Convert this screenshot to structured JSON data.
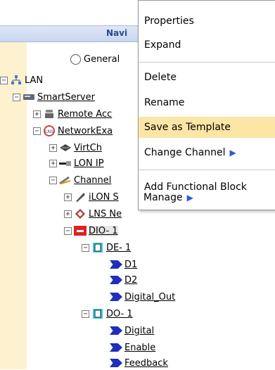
{
  "navigator": {
    "header": "Navi",
    "view_option": "General"
  },
  "tree": {
    "lan": "LAN",
    "smartserver": "SmartServer",
    "remote": "Remote Acc",
    "network": "NetworkExa",
    "virtch": "VirtCh",
    "lonip": "LON IP",
    "channel": "Channel",
    "ilon": "iLON S",
    "lns": "LNS Ne",
    "dio": "DIO- 1",
    "de1": "DE- 1",
    "d1": "D1",
    "d2": "D2",
    "digital_out": "Digital_Out",
    "do1": "DO- 1",
    "digital": "Digital",
    "enable": "Enable",
    "feedback": "Feedback"
  },
  "context_menu": {
    "items": [
      "Properties",
      "Expand",
      "Delete",
      "Rename",
      "Save as Template",
      "Change Channel",
      "Add Functional Block",
      "Manage"
    ],
    "submenu_arrow": "▶"
  },
  "colors": {
    "highlight": "#fbe6a6",
    "pin": "#1f2fb8",
    "leftbar": "#fdf1cf"
  }
}
